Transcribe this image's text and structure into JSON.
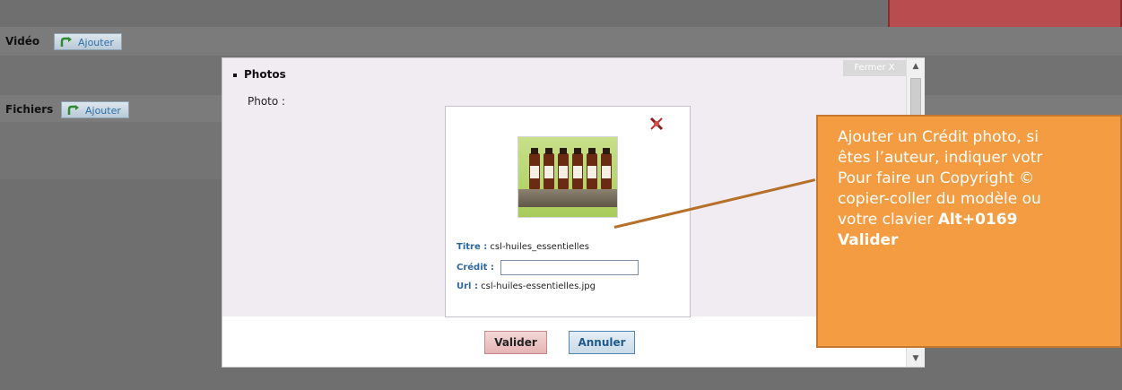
{
  "background_rows": {
    "video": {
      "label": "Vidéo",
      "add_label": "Ajouter"
    },
    "files": {
      "label": "Fichiers",
      "add_label": "Ajouter"
    }
  },
  "dialog": {
    "close_label": "Fermer X",
    "section_title": "Photos",
    "photo_label": "Photo :",
    "card": {
      "title_key": "Titre :",
      "title_value": "csl-huiles_essentielles",
      "credit_key": "Crédit :",
      "credit_value": "",
      "url_key": "Url :",
      "url_value": "csl-huiles-essentielles.jpg"
    },
    "buttons": {
      "validate": "Valider",
      "cancel": "Annuler"
    }
  },
  "callout": {
    "line1": "Ajouter un Crédit photo, si",
    "line2": "êtes l’auteur, indiquer votr",
    "line3": "Pour faire un Copyright ©",
    "line4": "copier-coller du modèle ou",
    "line5_prefix": "votre clavier ",
    "line5_bold": "Alt+0169",
    "line6_bold": "Valider"
  },
  "colors": {
    "callout_bg": "#f39c41",
    "top_red": "#b84c4e",
    "link_blue": "#2b67a3"
  }
}
